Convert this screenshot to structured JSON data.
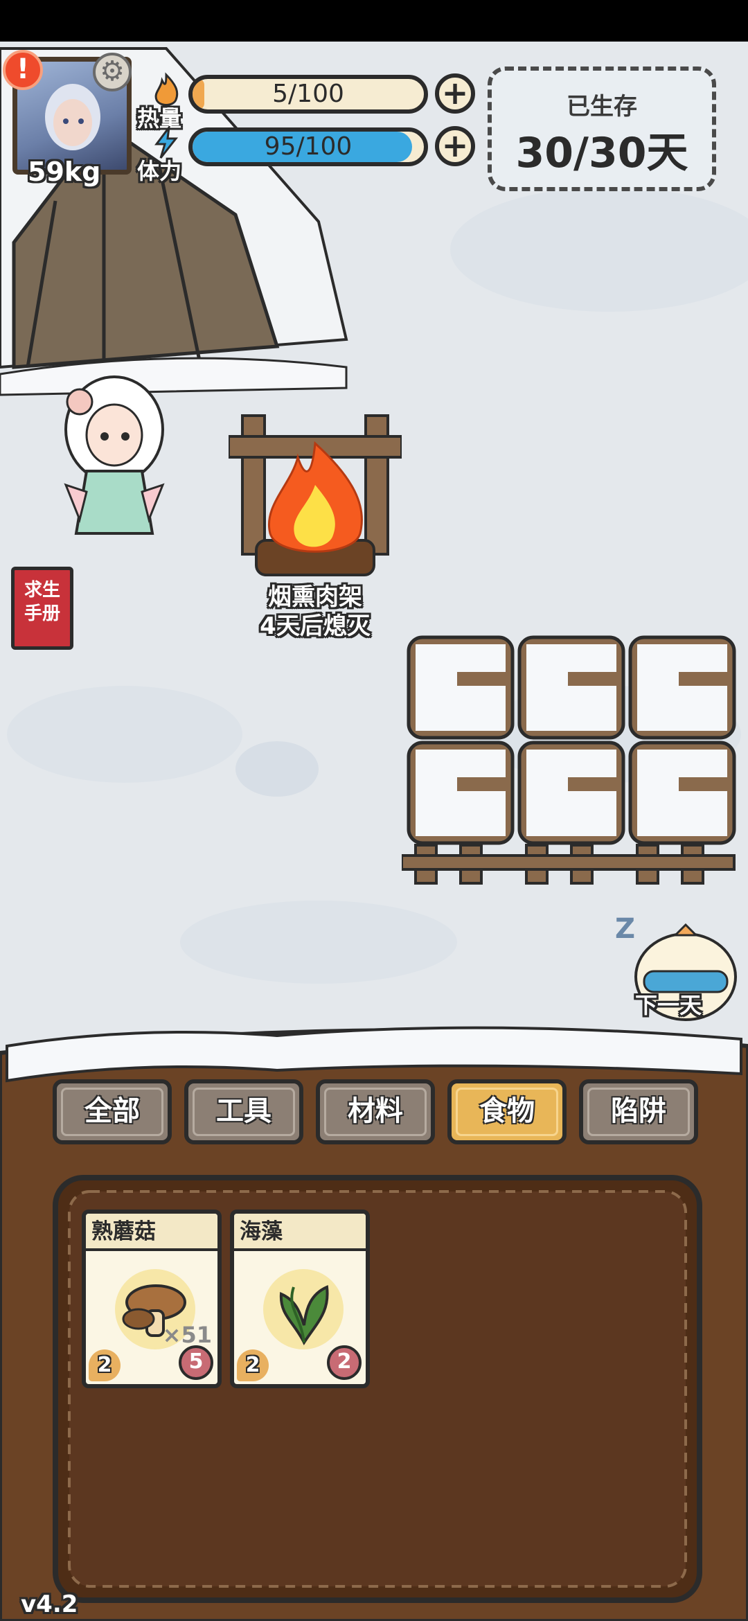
{
  "status": {
    "weight": "59kg",
    "heat_label": "热量",
    "heat_value": "5/100",
    "heat_progress": 0.05,
    "stamina_label": "体力",
    "stamina_value": "95/100",
    "stamina_progress": 0.95,
    "survived_label": "已生存",
    "survived_value": "30/30天"
  },
  "scene": {
    "fire_name": "烟熏肉架",
    "fire_status": "4天后熄灭",
    "manual_label": "求生手册",
    "next_day_label": "下一天"
  },
  "tabs": [
    {
      "label": "全部",
      "active": false
    },
    {
      "label": "工具",
      "active": false
    },
    {
      "label": "材料",
      "active": false
    },
    {
      "label": "食物",
      "active": true
    },
    {
      "label": "陷阱",
      "active": false
    }
  ],
  "items": [
    {
      "name": "熟蘑菇",
      "count": "×51",
      "left_badge": "2",
      "right_badge": "5",
      "icon": "mushroom-icon"
    },
    {
      "name": "海藻",
      "count": "",
      "left_badge": "2",
      "right_badge": "2",
      "icon": "seaweed-icon"
    }
  ],
  "version": "v4.2",
  "colors": {
    "heat_fill": "#f0a850",
    "stamina_fill": "#3aa8e0",
    "active_tab": "#e8b658",
    "inactive_tab": "#8c7f74",
    "wood": "#6b4325"
  }
}
